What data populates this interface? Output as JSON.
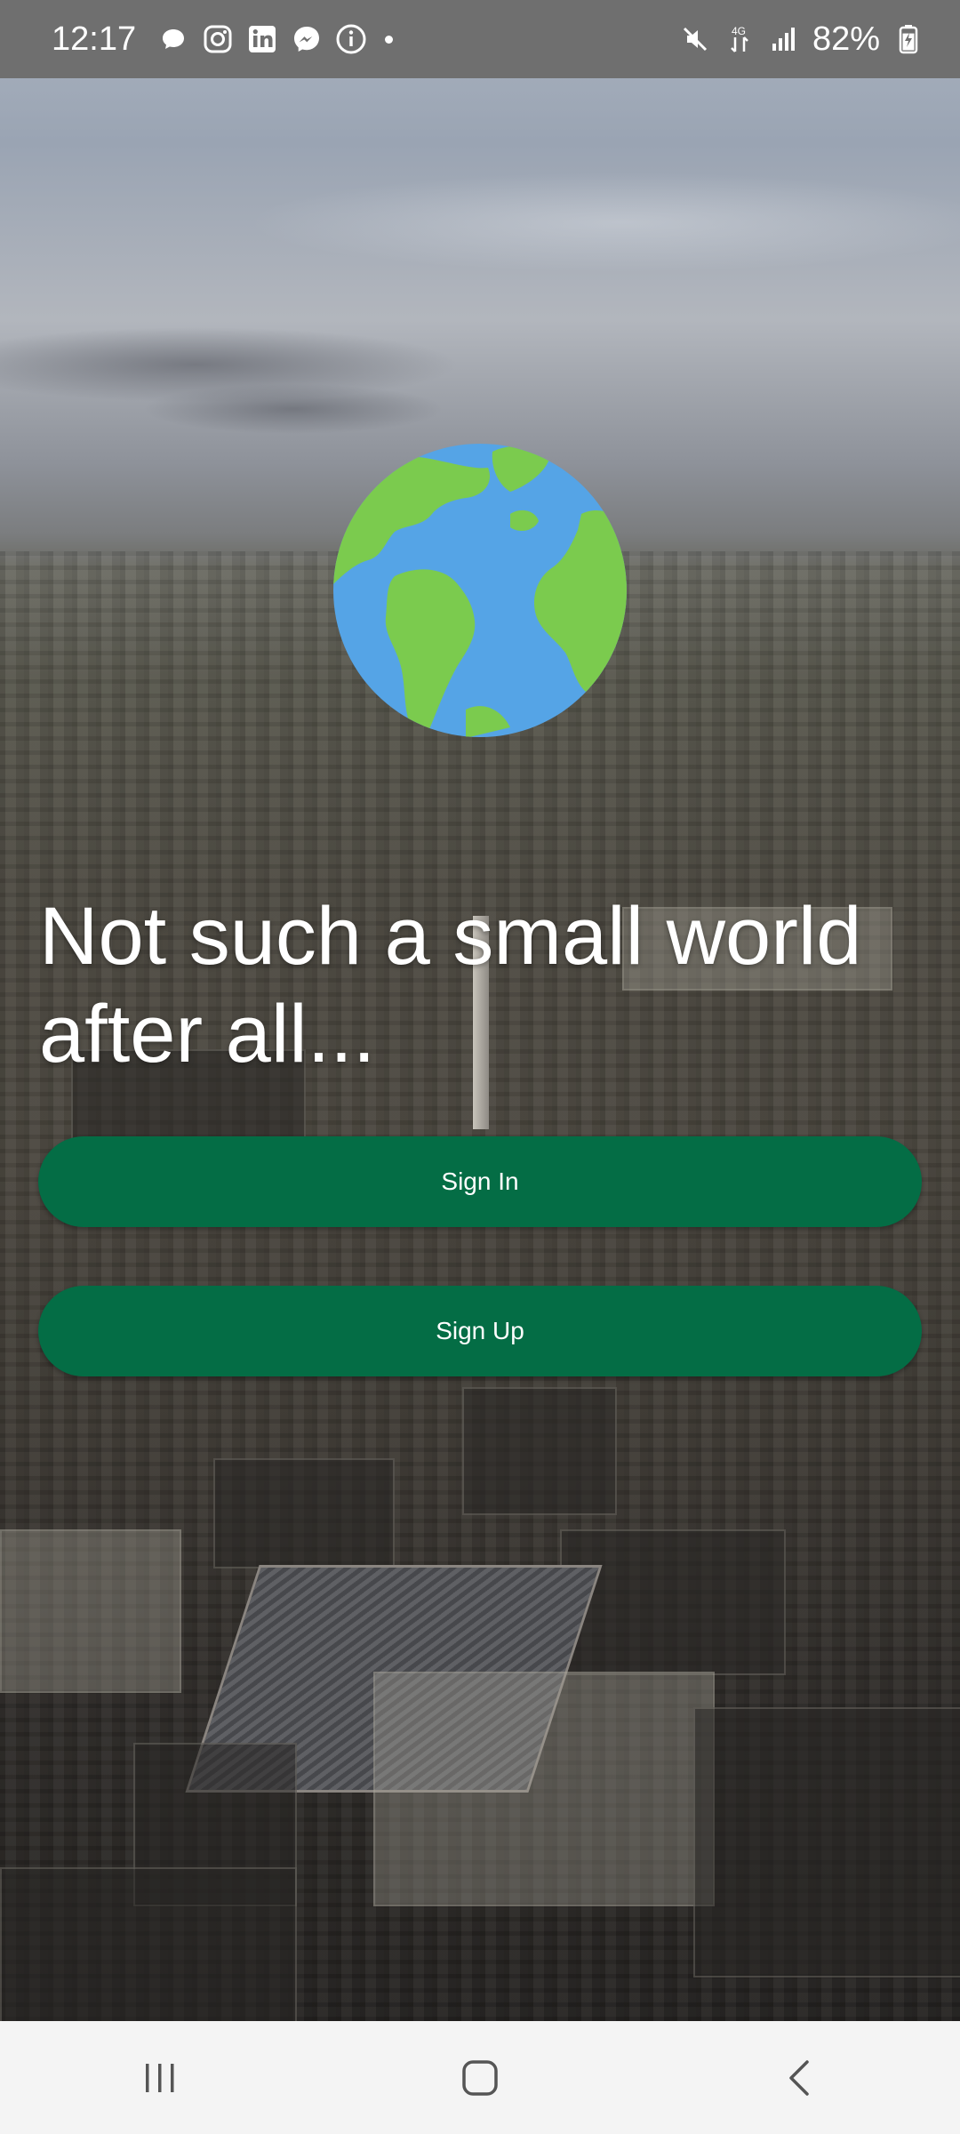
{
  "status_bar": {
    "time": "12:17",
    "notification_icons": [
      "chat-bubble-icon",
      "instagram-icon",
      "linkedin-icon",
      "messenger-icon",
      "info-icon",
      "more-dot-icon"
    ],
    "system_icons": [
      "mute-icon",
      "4g-data-icon",
      "signal-icon"
    ],
    "battery_percent": "82%",
    "battery_level": 0.82
  },
  "hero": {
    "logo": "globe-icon",
    "headline": "Not such a small world after all..."
  },
  "actions": {
    "sign_in_label": "Sign In",
    "sign_up_label": "Sign Up"
  },
  "colors": {
    "button_bg": "#046d45",
    "button_text": "#ffffff",
    "globe_ocean": "#55a4e6",
    "globe_land": "#7bcb4e",
    "status_bar_bg": "#6f6f6f",
    "nav_bar_bg": "#f4f4f4"
  },
  "nav_bar": {
    "buttons": [
      "recent-apps-icon",
      "home-icon",
      "back-icon"
    ]
  }
}
